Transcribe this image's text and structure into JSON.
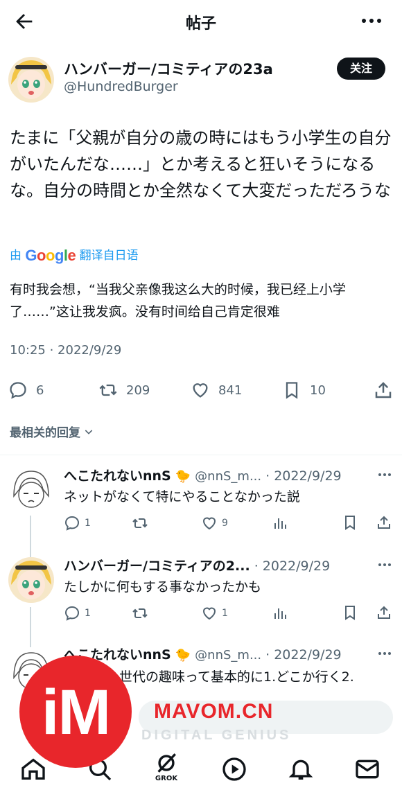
{
  "header": {
    "title": "帖子",
    "back_icon": "arrow-left-icon",
    "more_icon": "more-horizontal-icon"
  },
  "post": {
    "author_name": "ハンバーガー/コミティアの23a",
    "author_handle": "@HundredBurger",
    "follow_label": "关注",
    "text": "たまに「父親が自分の歳の時にはもう小学生の自分がいたんだな……」とか考えると狂いそうになるな。自分の時間とか全然なくて大変だっただろうな",
    "translate_prefix": "由",
    "translate_brand": "Google",
    "translate_suffix": "翻译自日语",
    "translated_text": "有时我会想，“当我父亲像我这么大的时候，我已经上小学了……”这让我发疯。没有时间给自己肯定很难",
    "timestamp": "10:25 · 2022/9/29",
    "stats": {
      "replies": "6",
      "reposts": "209",
      "likes": "841",
      "bookmarks": "10"
    }
  },
  "sort_label": "最相关的回复",
  "replies": [
    {
      "name": "へこたれないnnS",
      "handle": "@nnS_m...",
      "date": "· 2022/9/29",
      "text": "ネットがなくて特にやることなかった説",
      "reply_count": "1",
      "repost_count": "",
      "like_count": "9",
      "view_count": ""
    },
    {
      "name": "ハンバーガー/コミティアの2...",
      "handle": "",
      "date": "· 2022/9/29",
      "text": "たしかに何もする事なかったかも",
      "reply_count": "1",
      "repost_count": "",
      "like_count": "1",
      "view_count": ""
    },
    {
      "name": "へこたれないnnS",
      "handle": "@nnS_m...",
      "date": "· 2022/9/29",
      "text": "世代の趣味って基本的に1.どこか行く2.",
      "reply_count": "",
      "repost_count": "",
      "like_count": "",
      "view_count": ""
    }
  ],
  "bottom_nav": {
    "grok_label": "GROK"
  },
  "watermark": {
    "logo": "iM",
    "brand": "MAVOM.CN",
    "tagline": "DIGITAL GENIUS"
  },
  "colors": {
    "accent": "#1d9bf0",
    "text": "#0f1419",
    "muted": "#536471",
    "watermark_red": "#e8262b"
  }
}
